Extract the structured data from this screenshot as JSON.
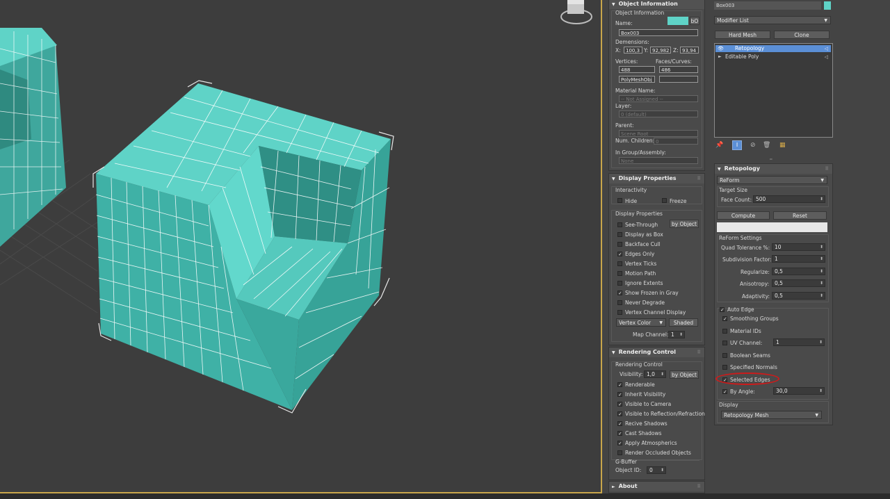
{
  "object_info": {
    "title": "Object Information",
    "group_label": "Object Information",
    "name_label": "Name:",
    "color_btn": "bO",
    "name_value": "Box003",
    "dimensions_label": "Demensions:",
    "x_label": "X:",
    "x_value": "100,3",
    "y_label": "Y:",
    "y_value": "92,982",
    "z_label": "Z:",
    "z_value": "93,94",
    "vertices_label": "Vertices:",
    "faces_label": "Faces/Curves:",
    "vertices_value": "488",
    "faces_value": "486",
    "class_value": "PolyMeshObj",
    "material_label": "Material Name:",
    "material_value": "-- Not Assigned --",
    "layer_label": "Layer:",
    "layer_value": "0 (default)",
    "parent_label": "Parent:",
    "parent_value": "Scene Root",
    "children_label": "Num. Children:",
    "children_value": "0",
    "group_assembly_label": "In Group/Assembly:",
    "group_assembly_value": "None"
  },
  "display_props": {
    "title": "Display Properties",
    "interactivity_label": "Interactivity",
    "hide": "Hide",
    "freeze": "Freeze",
    "group_label": "Display Properties",
    "by_object": "by Object",
    "items": [
      {
        "label": "See-Through",
        "checked": false
      },
      {
        "label": "Display as Box",
        "checked": false
      },
      {
        "label": "Backface Cull",
        "checked": false
      },
      {
        "label": "Edges Only",
        "checked": true
      },
      {
        "label": "Vertex Ticks",
        "checked": false
      },
      {
        "label": "Motion Path",
        "checked": false
      },
      {
        "label": "Ignore Extents",
        "checked": false
      },
      {
        "label": "Show Frozen in Gray",
        "checked": true
      },
      {
        "label": "Never Degrade",
        "checked": false
      },
      {
        "label": "Vertex Channel Display",
        "checked": false
      }
    ],
    "vertex_color": "Vertex Color",
    "shaded": "Shaded",
    "map_channel_label": "Map Channel:",
    "map_channel_value": "1"
  },
  "rendering": {
    "title": "Rendering Control",
    "group_label": "Rendering Control",
    "visibility_label": "Visibility:",
    "visibility_value": "1,0",
    "by_object": "by Object",
    "items": [
      {
        "label": "Renderable",
        "checked": true
      },
      {
        "label": "Inherit Visibility",
        "checked": true
      },
      {
        "label": "Visible to Camera",
        "checked": true
      },
      {
        "label": "Visible to Reflection/Refraction",
        "checked": true
      },
      {
        "label": "Recive Shadows",
        "checked": true
      },
      {
        "label": "Cast Shadows",
        "checked": true
      },
      {
        "label": "Apply Atmospherics",
        "checked": true
      },
      {
        "label": "Render Occluded Objects",
        "checked": false
      }
    ],
    "gbuffer_label": "G-Buffer",
    "object_id_label": "Object ID:",
    "object_id_value": "0"
  },
  "about": {
    "title": "About"
  },
  "modify": {
    "object_name": "Box003",
    "name_color": "#5fd3c7",
    "modifier_list": "Modifier List",
    "hard_mesh": "Hard Mesh",
    "clone": "Clone",
    "stack": [
      {
        "label": "Retopology",
        "selected": true
      },
      {
        "label": "Editable Poly",
        "selected": false
      }
    ]
  },
  "retopology": {
    "title": "Retopology",
    "mode": "ReForm",
    "target_size_label": "Target Size",
    "face_count_label": "Face Count:",
    "face_count_value": "500",
    "compute": "Compute",
    "reset": "Reset",
    "settings_label": "ReForm Settings",
    "quad_tol_label": "Quad Tolerance %:",
    "quad_tol_value": "10",
    "subdiv_label": "Subdivision Factor:",
    "subdiv_value": "1",
    "regularize_label": "Regularize:",
    "regularize_value": "0,5",
    "anisotropy_label": "Anisotropy:",
    "anisotropy_value": "0,5",
    "adaptivity_label": "Adaptivity:",
    "adaptivity_value": "0,5",
    "auto_edge": "Auto Edge",
    "smoothing_groups": "Smoothing Groups",
    "material_ids": "Material IDs",
    "uv_channel": "UV Channel:",
    "uv_channel_value": "1",
    "boolean_seams": "Boolean Seams",
    "specified_normals": "Specified Normals",
    "selected_edges": "Selected Edges",
    "by_angle": "By Angle:",
    "by_angle_value": "30,0",
    "display_label": "Display",
    "display_value": "Retopology Mesh"
  },
  "colors": {
    "mesh": "#5fd3c7",
    "accent": "#c9a64a",
    "highlight": "#cc1b1b",
    "selection": "#5b8fd6"
  }
}
